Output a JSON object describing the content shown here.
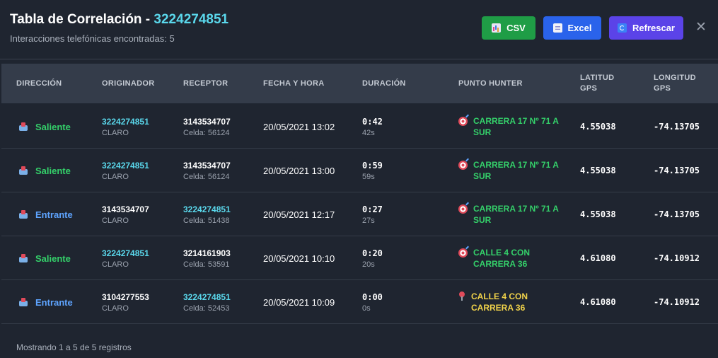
{
  "header": {
    "title": "Tabla de Correlación - ",
    "phone": "3224274851",
    "subtitle": "Interacciones telefónicas encontradas: 5"
  },
  "buttons": {
    "csv": "CSV",
    "excel": "Excel",
    "refresh": "Refrescar",
    "close": "✕"
  },
  "colors": {
    "csv": "#1f9d46",
    "excel": "#2a63eb",
    "refresh": "#5b43e8",
    "saliente": "#34d06a",
    "entrante": "#5ea4ff",
    "link": "#5ad8ec"
  },
  "table": {
    "headers": [
      "DIRECCIÓN",
      "ORIGINADOR",
      "RECEPTOR",
      "FECHA Y HORA",
      "DURACIÓN",
      "PUNTO HUNTER",
      "LATITUD GPS",
      "LONGITUD GPS"
    ],
    "rows": [
      {
        "direction": "Saliente",
        "origin": "3224274851",
        "origin_sub": "CLARO",
        "receiver": "3143534707",
        "receiver_sub": "Celda: 56124",
        "datetime": "20/05/2021 13:02",
        "duration": "0:42",
        "duration_sub": "42s",
        "hunter": "CARRERA 17 Nº 71 A SUR",
        "hunter_icon": "target-icon",
        "lat": "4.55038",
        "lon": "-74.13705"
      },
      {
        "direction": "Saliente",
        "origin": "3224274851",
        "origin_sub": "CLARO",
        "receiver": "3143534707",
        "receiver_sub": "Celda: 56124",
        "datetime": "20/05/2021 13:00",
        "duration": "0:59",
        "duration_sub": "59s",
        "hunter": "CARRERA 17 Nº 71 A SUR",
        "hunter_icon": "target-icon",
        "lat": "4.55038",
        "lon": "-74.13705"
      },
      {
        "direction": "Entrante",
        "origin": "3143534707",
        "origin_sub": "CLARO",
        "receiver": "3224274851",
        "receiver_sub": "Celda: 51438",
        "datetime": "20/05/2021 12:17",
        "duration": "0:27",
        "duration_sub": "27s",
        "hunter": "CARRERA 17 Nº 71 A SUR",
        "hunter_icon": "target-icon",
        "lat": "4.55038",
        "lon": "-74.13705"
      },
      {
        "direction": "Saliente",
        "origin": "3224274851",
        "origin_sub": "CLARO",
        "receiver": "3214161903",
        "receiver_sub": "Celda: 53591",
        "datetime": "20/05/2021 10:10",
        "duration": "0:20",
        "duration_sub": "20s",
        "hunter": "CALLE 4 CON CARRERA 36",
        "hunter_icon": "target-icon",
        "lat": "4.61080",
        "lon": "-74.10912"
      },
      {
        "direction": "Entrante",
        "origin": "3104277553",
        "origin_sub": "CLARO",
        "receiver": "3224274851",
        "receiver_sub": "Celda: 52453",
        "datetime": "20/05/2021 10:09",
        "duration": "0:00",
        "duration_sub": "0s",
        "hunter": "CALLE 4 CON CARRERA 36",
        "hunter_icon": "pin-icon",
        "lat": "4.61080",
        "lon": "-74.10912"
      }
    ]
  },
  "footer": "Mostrando 1 a 5 de 5 registros"
}
